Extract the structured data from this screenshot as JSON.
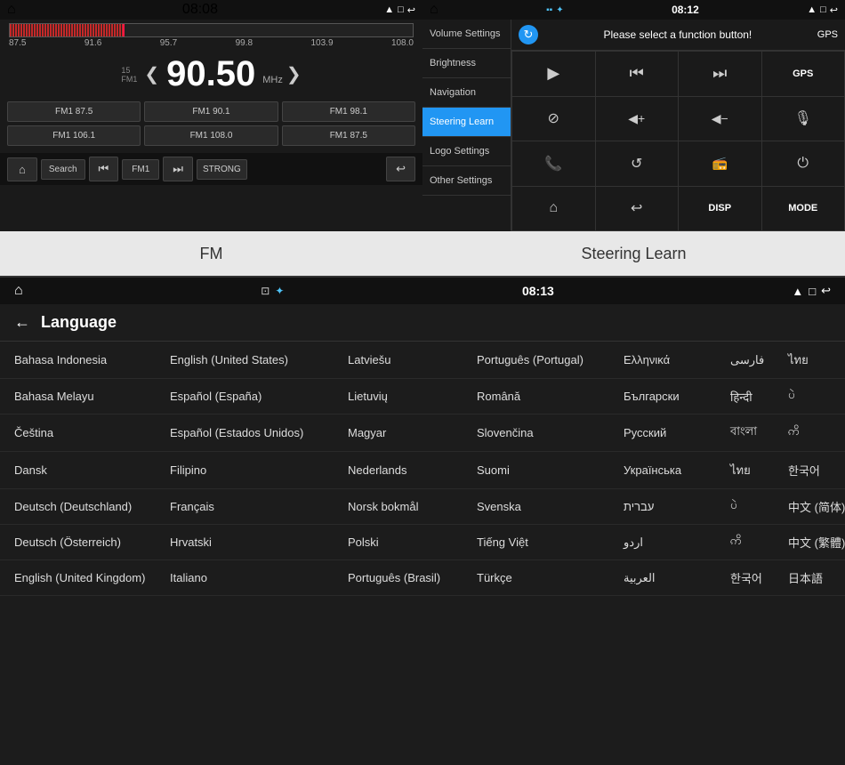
{
  "fm": {
    "title": "FM",
    "statusBar": {
      "time": "08:08",
      "homeIcon": "⌂",
      "rightIcons": "▲ □ ↩"
    },
    "freqMarkers": [
      "87.5",
      "91.6",
      "95.7",
      "99.8",
      "103.9",
      "108.0"
    ],
    "bandLabel": "FM1",
    "frequency": "90.50",
    "mhz": "MHz",
    "arrowLeft": "❮",
    "arrowRight": "❯",
    "presets": [
      [
        "FM1 87.5",
        "FM1 90.1",
        "FM1 98.1"
      ],
      [
        "FM1 106.1",
        "FM1 108.0",
        "FM1 87.5"
      ]
    ],
    "controls": {
      "homeBtn": "⌂",
      "searchBtn": "Search",
      "prevBtn": "⏮",
      "fmLabel": "FM1",
      "nextBtn": "⏭",
      "strongBtn": "STRONG",
      "backBtn": "↩"
    },
    "bottomLabel": "FM"
  },
  "steering": {
    "title": "Steering Learn",
    "statusBar": {
      "time": "08:12",
      "homeIcon": "⌂",
      "rightIcons": "▲ □ ↩"
    },
    "sidebar": [
      {
        "label": "Volume Settings",
        "active": false
      },
      {
        "label": "Brightness",
        "active": false
      },
      {
        "label": "Navigation",
        "active": false
      },
      {
        "label": "Steering Learn",
        "active": true
      },
      {
        "label": "Logo Settings",
        "active": false
      },
      {
        "label": "Other Settings",
        "active": false
      }
    ],
    "header": {
      "prompt": "Please select a function button!",
      "gpsLabel": "GPS",
      "refreshIcon": "↻"
    },
    "buttons": [
      {
        "icon": "▶",
        "type": "icon"
      },
      {
        "icon": "⏮",
        "type": "icon"
      },
      {
        "icon": "⏭",
        "type": "icon"
      },
      {
        "label": "GPS",
        "type": "text"
      },
      {
        "icon": "⊘",
        "type": "icon"
      },
      {
        "icon": "🔊+",
        "type": "icon"
      },
      {
        "icon": "🔊-",
        "type": "icon"
      },
      {
        "icon": "🎤",
        "type": "icon"
      },
      {
        "icon": "📞",
        "type": "icon"
      },
      {
        "icon": "↺",
        "type": "icon"
      },
      {
        "icon": "📻",
        "type": "icon"
      },
      {
        "icon": "⏻",
        "type": "icon"
      },
      {
        "icon": "⌂",
        "type": "icon"
      },
      {
        "icon": "↩",
        "type": "icon"
      },
      {
        "label": "DISP",
        "type": "text"
      },
      {
        "label": "MODE",
        "type": "text"
      }
    ],
    "bottomLabel": "Steering Learn"
  },
  "language": {
    "statusBar": {
      "time": "08:13",
      "homeIcon": "⌂",
      "rightIcons": "▲ □ ↩",
      "castIcon": "⊡",
      "btIcon": "✦"
    },
    "header": {
      "backArrow": "←",
      "title": "Language"
    },
    "rows": [
      [
        "Bahasa Indonesia",
        "English (United States)",
        "Latviešu",
        "Português (Portugal)",
        "Ελληνικά",
        "فارسی",
        "ไทย"
      ],
      [
        "Bahasa Melayu",
        "Español (España)",
        "Lietuvių",
        "Română",
        "Български",
        "हिन्दी",
        "ပဲ"
      ],
      [
        "Čeština",
        "Español (Estados Unidos)",
        "Magyar",
        "Slovenčina",
        "Русский",
        "বাংলা",
        "ဢိ"
      ],
      [
        "Dansk",
        "Filipino",
        "Nederlands",
        "Suomi",
        "Українська",
        "ไทย",
        "한국어"
      ],
      [
        "Deutsch (Deutschland)",
        "Français",
        "Norsk bokmål",
        "Svenska",
        "עברית",
        "ပဲ",
        "中文 (简体)"
      ],
      [
        "Deutsch (Österreich)",
        "Hrvatski",
        "Polski",
        "Tiếng Việt",
        "اردو",
        "ဢိ",
        "中文 (繁體)"
      ],
      [
        "English (United Kingdom)",
        "Italiano",
        "Português (Brasil)",
        "Türkçe",
        "العربية",
        "한국어",
        "日本語"
      ]
    ]
  }
}
